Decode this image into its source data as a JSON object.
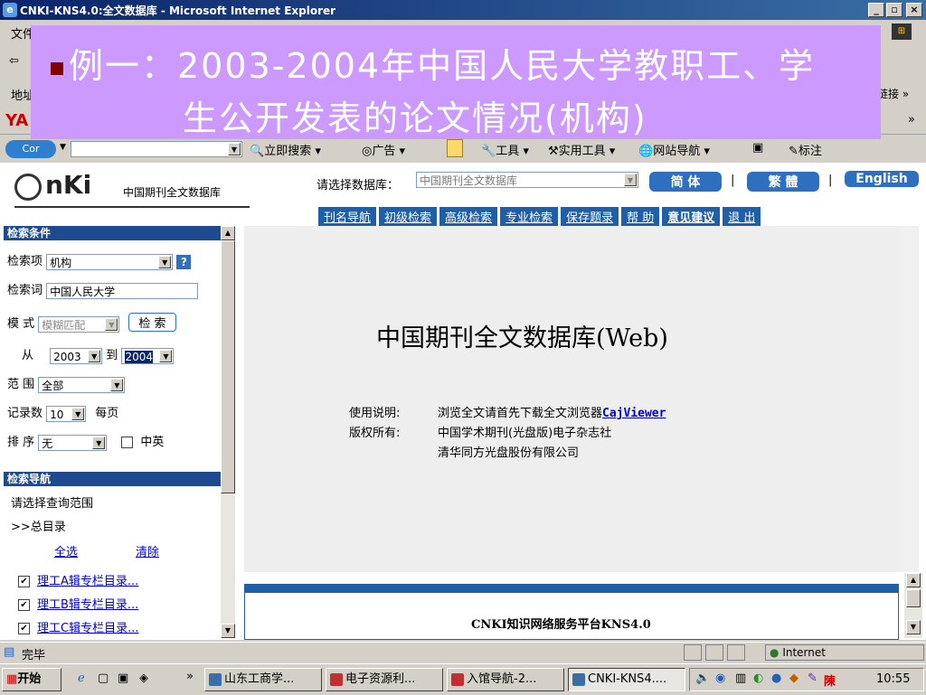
{
  "window": {
    "title": "CNKI-KNS4.0:全文数据库 - Microsoft Internet Explorer"
  },
  "ie": {
    "menu_partial": "文件",
    "back_partial": "⇦",
    "address_partial": "地址",
    "links_label": "链接 »",
    "toolbar_more": "»",
    "yahoo_partial": "YA"
  },
  "overlay": {
    "line1": "例一：2003-2004年中国人民大学教职工、学",
    "line2": "生公开发表的论文情况(机构)"
  },
  "search_toolbar": {
    "search_label": "立即搜索",
    "ads_label": "广告",
    "tools_label": "工具",
    "practical_tools_label": "实用工具",
    "site_nav_label": "网站导航",
    "bookmark_label": "标注"
  },
  "header": {
    "logo_text": "nKi",
    "logo_subtitle": "中国期刊全文数据库",
    "db_select_label": "请选择数据库：",
    "db_select_value": "中国期刊全文数据库",
    "lang_simplified": "简  体",
    "lang_traditional": "繁  體",
    "lang_english": "English",
    "nav": [
      "刊名导航",
      "初级检索",
      "高级检索",
      "专业检索",
      "保存题录",
      "帮 助",
      "意见建议",
      "退 出"
    ]
  },
  "search_panel": {
    "title": "检索条件",
    "field_label": "检索项",
    "field_value": "机构",
    "term_label": "检索词",
    "term_value": "中国人民大学",
    "mode_label": "模  式",
    "mode_value": "模糊匹配",
    "search_button": "检  索",
    "from_label": "从",
    "from_value": "2003",
    "to_label": "到",
    "to_value": "2004",
    "range_label": "范  围",
    "range_value": "全部",
    "records_label": "记录数",
    "records_value": "10",
    "per_page": "每页",
    "sort_label": "排  序",
    "sort_value": "无",
    "cn_en_label": "中英"
  },
  "nav_panel": {
    "title": "检索导航",
    "prompt": "请选择查询范围",
    "root": ">>总目录",
    "select_all": "全选",
    "clear": "清除",
    "items": [
      "理工A辑专栏目录...",
      "理工B辑专栏目录...",
      "理工C辑专栏目录..."
    ]
  },
  "main": {
    "heading": "中国期刊全文数据库(Web)",
    "usage_label": "使用说明:",
    "usage_text": "浏览全文请首先下载全文浏览器",
    "usage_link": "CajViewer",
    "copyright_label": "版权所有:",
    "copyright_line1": "中国学术期刊(光盘版)电子杂志社",
    "copyright_line2": "清华同方光盘股份有限公司",
    "footer_text": "CNKI知识网络服务平台KNS4.0"
  },
  "status": {
    "text": "完毕",
    "zone": "Internet"
  },
  "taskbar": {
    "start": "开始",
    "chevron": "»",
    "tasks": [
      "山东工商学...",
      "电子资源利...",
      "入馆导航-2...",
      "CNKI-KNS4...."
    ],
    "tray_ime": "陳",
    "clock": "10:55"
  },
  "colors": {
    "overlay_bg": "#cc99ff",
    "panel_head": "#1e4b8f",
    "nav_tab": "#1e5fa8",
    "link": "#0000cc"
  }
}
